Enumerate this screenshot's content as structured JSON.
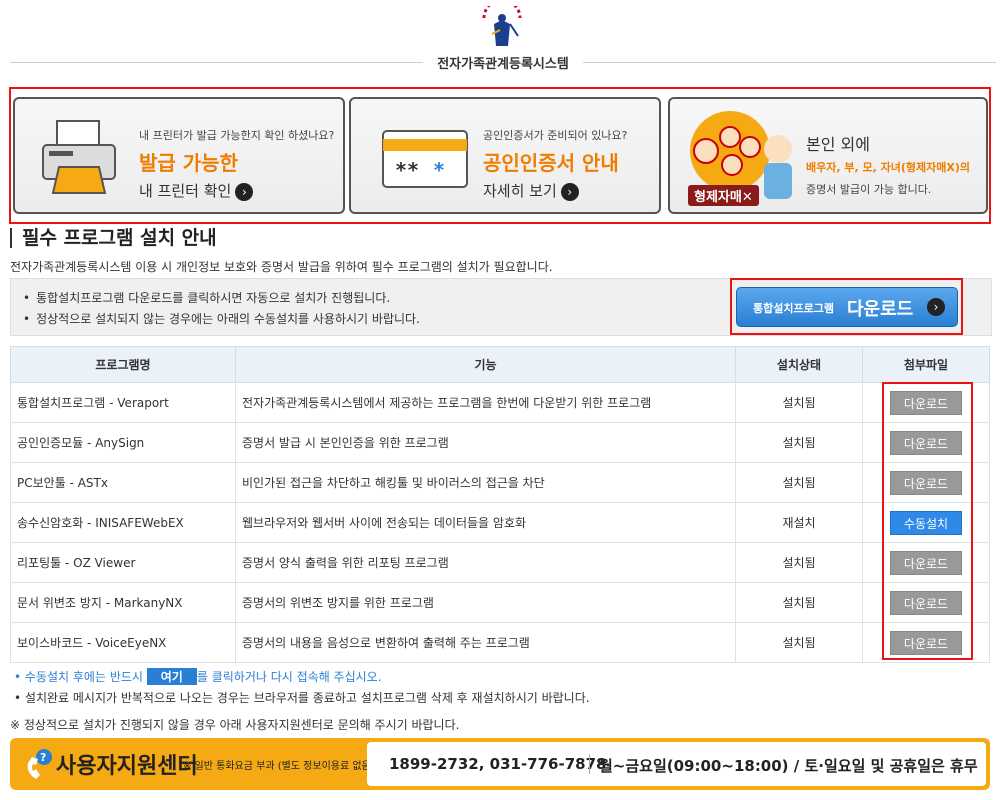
{
  "header": {
    "title": "전자가족관계등록시스템"
  },
  "cards": [
    {
      "small": "내 프린터가 발급 가능한지 확인 하셨나요?",
      "big": "발급 가능한",
      "mid": "내 프린터 확인"
    },
    {
      "small": "공인인증서가 준비되어 있나요?",
      "big": "공인인증서 안내",
      "mid": "자세히 보기"
    },
    {
      "line1": "본인 외에",
      "line2": "배우자, 부, 모, 자녀(형제자매X)의",
      "line3": "증명서 발급이 가능 합니다.",
      "badge": "형제자매✕"
    }
  ],
  "section": {
    "title": "필수 프로그램 설치 안내",
    "desc": "전자가족관계등록시스템 이용 시 개인정보 보호와 증명서 발급을 위하여 필수 프로그램의 설치가 필요합니다.",
    "notice1": "통합설치프로그램 다운로드를 클릭하시면 자동으로 설치가 진행됩니다.",
    "notice2": "정상적으로 설치되지 않는 경우에는 아래의 수동설치를 사용하시기 바랍니다.",
    "download_small": "통합설치프로그램",
    "download_big": "다운로드"
  },
  "table": {
    "headers": [
      "프로그램명",
      "기능",
      "설치상태",
      "첨부파일"
    ],
    "rows": [
      {
        "name": "통합설치프로그램 - Veraport",
        "func": "전자가족관계등록시스템에서 제공하는 프로그램을 한번에 다운받기 위한 프로그램",
        "status": "설치됨",
        "action": "다운로드"
      },
      {
        "name": "공인인증모듈 - AnySign",
        "func": "증명서 발급 시 본인인증을 위한 프로그램",
        "status": "설치됨",
        "action": "다운로드"
      },
      {
        "name": "PC보안툴 - ASTx",
        "func": "비인가된 접근을 차단하고 해킹툴 및 바이러스의 접근을 차단",
        "status": "설치됨",
        "action": "다운로드"
      },
      {
        "name": "송수신암호화 - INISAFEWebEX",
        "func": "웹브라우저와 웹서버 사이에 전송되는 데이터들을 암호화",
        "status": "재설치",
        "action": "수동설치"
      },
      {
        "name": "리포팅툴 - OZ Viewer",
        "func": "증명서 양식 출력을 위한 리포팅 프로그램",
        "status": "설치됨",
        "action": "다운로드"
      },
      {
        "name": "문서 위변조 방지 - MarkanyNX",
        "func": "증명서의 위변조 방지를 위한 프로그램",
        "status": "설치됨",
        "action": "다운로드"
      },
      {
        "name": "보이스바코드 - VoiceEyeNX",
        "func": "증명서의 내용을 음성으로 변환하여 출력해 주는 프로그램",
        "status": "설치됨",
        "action": "다운로드"
      }
    ]
  },
  "notes": {
    "line1_pre": "수동설치 후에는 반드시",
    "here": "여기",
    "line1_post": "를 클릭하거나 다시 접속해 주십시오.",
    "line2": "설치완료 메시지가 반복적으로 나오는 경우는 브라우저를 종료하고 설치프로그램 삭제 후 재설치하시기 바랍니다.",
    "final": "※ 정상적으로 설치가 진행되지 않을 경우 아래 사용자지원센터로 문의해 주시기 바랍니다."
  },
  "support": {
    "title": "사용자지원센터",
    "sub": "※ 일반 통화요금 부과 (별도 정보이용료 없음)",
    "phones": "1899-2732, 031-776-7878",
    "hours": "월~금요일(09:00~18:00) / 토·일요일 및 공휴일은 휴무"
  }
}
